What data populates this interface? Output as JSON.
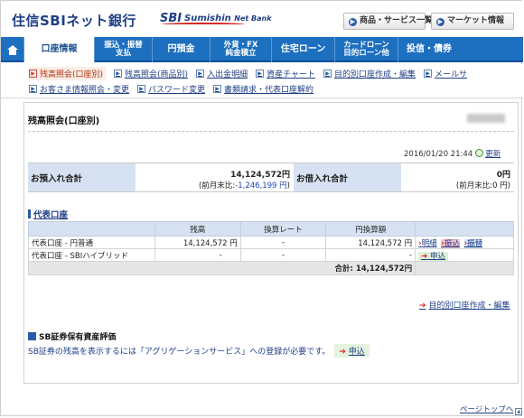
{
  "header": {
    "logo_jp": "住信SBIネット銀行",
    "logo_sbi": "SBI",
    "logo_name": "Sumishin",
    "logo_netbank": "Net Bank",
    "top_buttons": [
      {
        "icon": "circle-arrow-icon",
        "label": "商品・サービス一覧"
      },
      {
        "icon": "circle-arrow-icon",
        "label": "マーケット情報"
      }
    ]
  },
  "nav": {
    "home_icon": "home-icon",
    "items": [
      {
        "label": "口座情報",
        "active": true
      },
      {
        "label_line1": "振込・振替",
        "label_line2": "支払"
      },
      {
        "label": "円預金"
      },
      {
        "label_line1": "外貨・FX",
        "label_line2": "純金積立"
      },
      {
        "label": "住宅ローン"
      },
      {
        "label_line1": "カードローン",
        "label_line2": "目的ローン他"
      },
      {
        "label": "投信・債券"
      }
    ]
  },
  "subnav": {
    "row1": [
      "残高照会(口座別)",
      "残高照会(商品別)",
      "入出金明細",
      "資産チャート",
      "目的別口座作成・編集",
      "メールサ"
    ],
    "row2": [
      "お客さま情報照会・変更",
      "パスワード変更",
      "書類請求・代表口座解約"
    ]
  },
  "page": {
    "title": "残高照会(口座別)",
    "timestamp": "2016/01/20 21:44",
    "refresh_label": "更新"
  },
  "summary": {
    "deposit_label": "お預入れ合計",
    "deposit_value": "14,124,572円",
    "deposit_diff_prefix": "(前月末比:",
    "deposit_diff_value": "-1,246,199 円",
    "deposit_diff_suffix": ")",
    "borrow_label": "お借入れ合計",
    "borrow_value": "0円",
    "borrow_diff": "(前月末比:0 円)"
  },
  "accounts": {
    "section_title": "代表口座",
    "headers": [
      "",
      "残高",
      "換算レート",
      "円換算額",
      ""
    ],
    "rows": [
      {
        "name": "代表口座 - 円普通",
        "balance": "14,124,572 円",
        "rate": "-",
        "yen": "14,124,572 円",
        "actions": [
          "明細",
          "振込",
          "振替"
        ]
      },
      {
        "name": "代表口座 - SBIハイブリッド",
        "balance": "-",
        "rate": "-",
        "yen": "-",
        "actions": [
          "申込"
        ]
      }
    ],
    "total": "合計: 14,124,572円",
    "create_link": "目的別口座作成・編集"
  },
  "sb": {
    "title": "SB証券保有資産評価",
    "text": "SB証券の残高を表示するには「アグリゲーションサービス」への登録が必要です。",
    "apply_label": "申込"
  },
  "footer": {
    "pagetop": "ページトップへ"
  },
  "colors": {
    "nav_bg": "#1d6fbf",
    "brand": "#1f3f86",
    "label_bg": "#d6e2f1",
    "accent_red": "#d12323"
  }
}
